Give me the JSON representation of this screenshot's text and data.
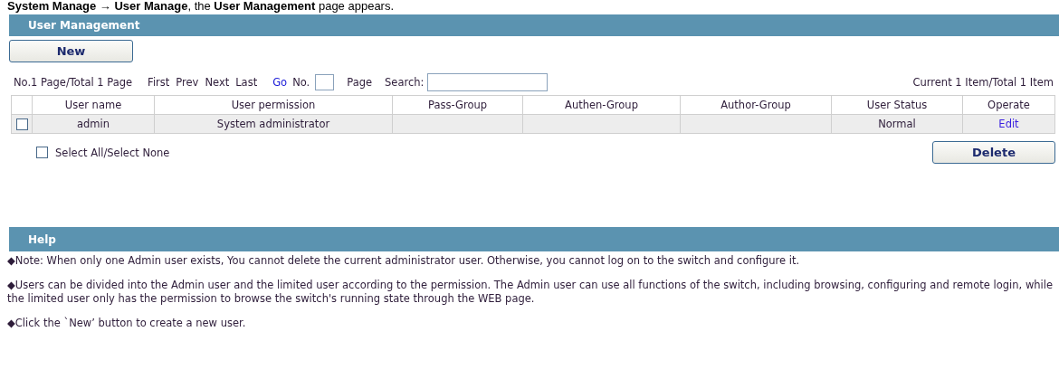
{
  "caption": "**System Manage → User Manage**, the **User Management** page appears.",
  "panel": {
    "title": "User Management"
  },
  "new_button": "New",
  "pager": {
    "page_info": "No.1 Page/Total 1 Page",
    "links": [
      "First",
      "Prev",
      "Next",
      "Last"
    ],
    "go": "Go",
    "no_label": "No.",
    "page_label": "Page",
    "search_label": "Search:",
    "item_info": "Current 1 Item/Total 1 Item"
  },
  "table": {
    "columns": [
      "User name",
      "User permission",
      "Pass-Group",
      "Authen-Group",
      "Author-Group",
      "User Status",
      "Operate"
    ],
    "rows": [
      {
        "checked": false,
        "user_name": "admin",
        "permission": "System administrator",
        "status": "Normal",
        "operate": "Edit"
      }
    ]
  },
  "select_all": {
    "label": "Select All/Select None",
    "checked": false
  },
  "delete_button": "Delete",
  "help": {
    "title": "Help",
    "notes": [
      "◆Note: When only one Admin user exists, You cannot delete the current administrator user. Otherwise, you cannot log on to the switch and configure it.",
      "◆Users can be divided into the Admin user and the limited user according to the permission. The Admin user can use all functions of the switch, including browsing, configuring and remote login, while the limited user only has the permission to browse the switch's running state through the WEB page.",
      "◆Click the `New’ button to create a new user."
    ]
  }
}
